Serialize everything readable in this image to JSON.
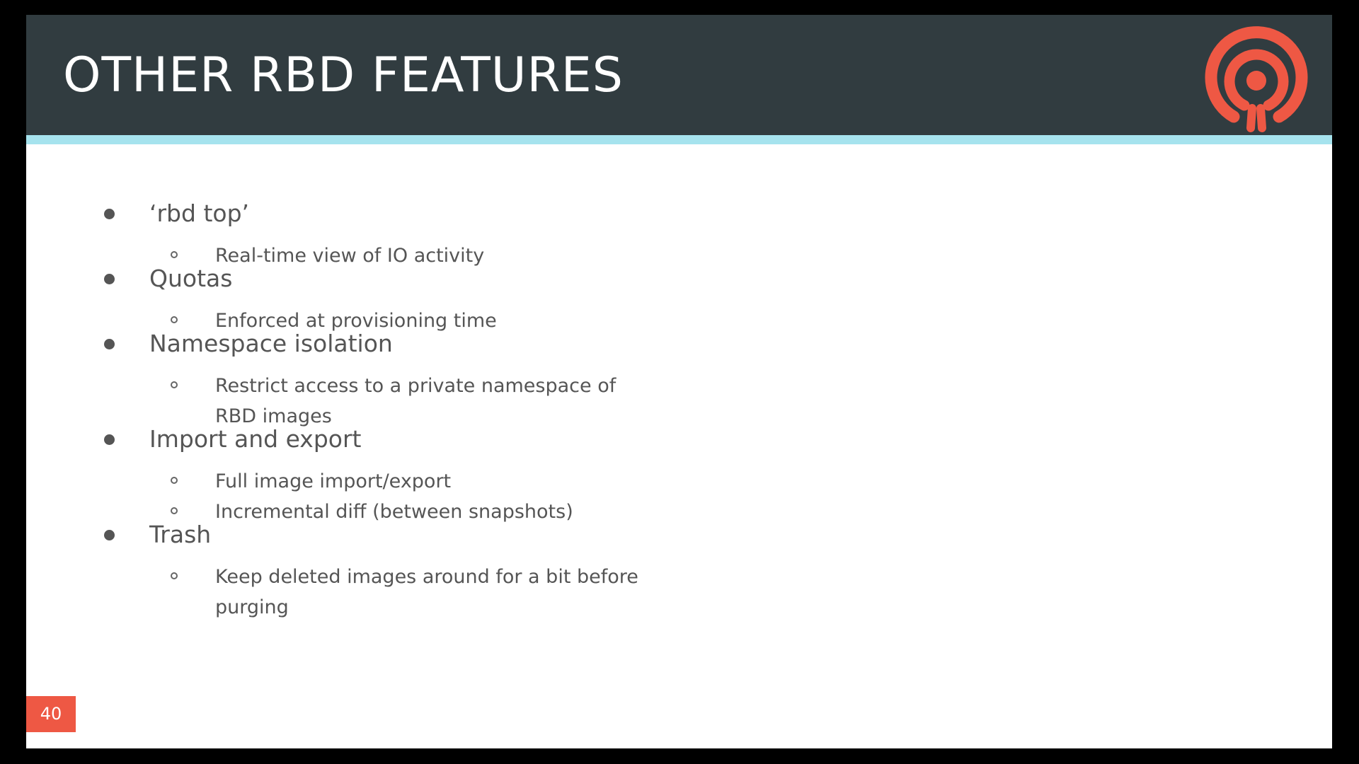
{
  "slide": {
    "title": "OTHER RBD FEATURES",
    "page_number": "40",
    "logo_icon": "ceph-logo-icon",
    "colors": {
      "header_bg": "#313c40",
      "header_stripe": "#a6e3ee",
      "logo": "#ee5844",
      "page_badge": "#ee5844",
      "body_text": "#555555"
    }
  },
  "bullets": [
    {
      "text": "‘rbd top’",
      "subs": [
        "Real-time view of IO activity"
      ]
    },
    {
      "text": "Quotas",
      "subs": [
        "Enforced at provisioning time"
      ]
    },
    {
      "text": "Namespace isolation",
      "subs": [
        "Restrict access to a private namespace of RBD images"
      ]
    },
    {
      "text": "Import and export",
      "subs": [
        "Full image import/export",
        "Incremental diff (between snapshots)"
      ]
    },
    {
      "text": "Trash",
      "subs": [
        "Keep deleted images around for a bit before purging"
      ]
    }
  ]
}
